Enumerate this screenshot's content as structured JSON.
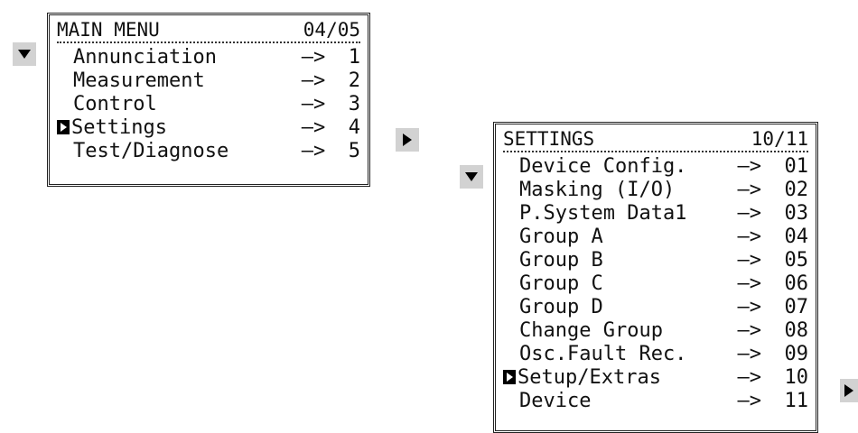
{
  "main_menu": {
    "title": "MAIN MENU",
    "page": "04/05",
    "items": [
      {
        "label": "Annunciation",
        "arrow": "–>",
        "num": "1",
        "selected": false
      },
      {
        "label": "Measurement",
        "arrow": "–>",
        "num": "2",
        "selected": false
      },
      {
        "label": "Control",
        "arrow": "–>",
        "num": "3",
        "selected": false
      },
      {
        "label": "Settings",
        "arrow": "–>",
        "num": "4",
        "selected": true
      },
      {
        "label": "Test/Diagnose",
        "arrow": "–>",
        "num": "5",
        "selected": false
      }
    ]
  },
  "settings_menu": {
    "title": "SETTINGS",
    "page": "10/11",
    "items": [
      {
        "label": "Device Config.",
        "arrow": "–>",
        "num": "01",
        "selected": false
      },
      {
        "label": "Masking (I/O)",
        "arrow": "–>",
        "num": "02",
        "selected": false
      },
      {
        "label": "P.System Data1",
        "arrow": "–>",
        "num": "03",
        "selected": false
      },
      {
        "label": "Group A",
        "arrow": "–>",
        "num": "04",
        "selected": false
      },
      {
        "label": "Group B",
        "arrow": "–>",
        "num": "05",
        "selected": false
      },
      {
        "label": "Group C",
        "arrow": "–>",
        "num": "06",
        "selected": false
      },
      {
        "label": "Group D",
        "arrow": "–>",
        "num": "07",
        "selected": false
      },
      {
        "label": "Change Group",
        "arrow": "–>",
        "num": "08",
        "selected": false
      },
      {
        "label": "Osc.Fault Rec.",
        "arrow": "–>",
        "num": "09",
        "selected": false
      },
      {
        "label": "Setup/Extras",
        "arrow": "–>",
        "num": "10",
        "selected": true
      },
      {
        "label": "Device",
        "arrow": "–>",
        "num": "11",
        "selected": false
      }
    ]
  },
  "icons": {
    "down": "triangle-down-icon",
    "right": "triangle-right-icon",
    "cursor": "selection-cursor-icon"
  }
}
